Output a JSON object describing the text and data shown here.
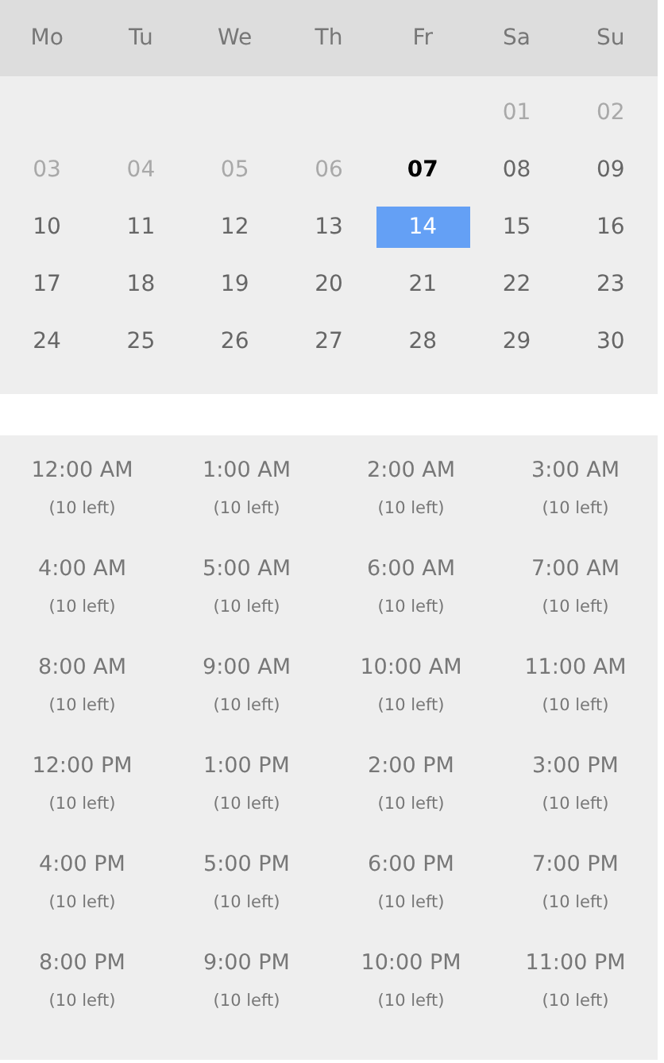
{
  "weekdays": [
    "Mo",
    "Tu",
    "We",
    "Th",
    "Fr",
    "Sa",
    "Su"
  ],
  "weeks": [
    [
      {
        "label": "01",
        "kind": "muted",
        "selected": false
      },
      {
        "label": "02",
        "kind": "muted",
        "selected": false
      }
    ],
    [
      {
        "label": "03",
        "kind": "muted",
        "selected": false
      },
      {
        "label": "04",
        "kind": "muted",
        "selected": false
      },
      {
        "label": "05",
        "kind": "muted",
        "selected": false
      },
      {
        "label": "06",
        "kind": "muted",
        "selected": false
      },
      {
        "label": "07",
        "kind": "today",
        "selected": false
      },
      {
        "label": "08",
        "kind": "normal",
        "selected": false
      },
      {
        "label": "09",
        "kind": "normal",
        "selected": false
      }
    ],
    [
      {
        "label": "10",
        "kind": "normal",
        "selected": false
      },
      {
        "label": "11",
        "kind": "normal",
        "selected": false
      },
      {
        "label": "12",
        "kind": "normal",
        "selected": false
      },
      {
        "label": "13",
        "kind": "normal",
        "selected": false
      },
      {
        "label": "14",
        "kind": "normal",
        "selected": true
      },
      {
        "label": "15",
        "kind": "normal",
        "selected": false
      },
      {
        "label": "16",
        "kind": "normal",
        "selected": false
      }
    ],
    [
      {
        "label": "17",
        "kind": "normal",
        "selected": false
      },
      {
        "label": "18",
        "kind": "normal",
        "selected": false
      },
      {
        "label": "19",
        "kind": "normal",
        "selected": false
      },
      {
        "label": "20",
        "kind": "normal",
        "selected": false
      },
      {
        "label": "21",
        "kind": "normal",
        "selected": false
      },
      {
        "label": "22",
        "kind": "normal",
        "selected": false
      },
      {
        "label": "23",
        "kind": "normal",
        "selected": false
      }
    ],
    [
      {
        "label": "24",
        "kind": "normal",
        "selected": false
      },
      {
        "label": "25",
        "kind": "normal",
        "selected": false
      },
      {
        "label": "26",
        "kind": "normal",
        "selected": false
      },
      {
        "label": "27",
        "kind": "normal",
        "selected": false
      },
      {
        "label": "28",
        "kind": "normal",
        "selected": false
      },
      {
        "label": "29",
        "kind": "normal",
        "selected": false
      },
      {
        "label": "30",
        "kind": "normal",
        "selected": false
      }
    ]
  ],
  "time_slots": [
    {
      "time": "12:00 AM",
      "availability": "(10 left)"
    },
    {
      "time": "1:00 AM",
      "availability": "(10 left)"
    },
    {
      "time": "2:00 AM",
      "availability": "(10 left)"
    },
    {
      "time": "3:00 AM",
      "availability": "(10 left)"
    },
    {
      "time": "4:00 AM",
      "availability": "(10 left)"
    },
    {
      "time": "5:00 AM",
      "availability": "(10 left)"
    },
    {
      "time": "6:00 AM",
      "availability": "(10 left)"
    },
    {
      "time": "7:00 AM",
      "availability": "(10 left)"
    },
    {
      "time": "8:00 AM",
      "availability": "(10 left)"
    },
    {
      "time": "9:00 AM",
      "availability": "(10 left)"
    },
    {
      "time": "10:00 AM",
      "availability": "(10 left)"
    },
    {
      "time": "11:00 AM",
      "availability": "(10 left)"
    },
    {
      "time": "12:00 PM",
      "availability": "(10 left)"
    },
    {
      "time": "1:00 PM",
      "availability": "(10 left)"
    },
    {
      "time": "2:00 PM",
      "availability": "(10 left)"
    },
    {
      "time": "3:00 PM",
      "availability": "(10 left)"
    },
    {
      "time": "4:00 PM",
      "availability": "(10 left)"
    },
    {
      "time": "5:00 PM",
      "availability": "(10 left)"
    },
    {
      "time": "6:00 PM",
      "availability": "(10 left)"
    },
    {
      "time": "7:00 PM",
      "availability": "(10 left)"
    },
    {
      "time": "8:00 PM",
      "availability": "(10 left)"
    },
    {
      "time": "9:00 PM",
      "availability": "(10 left)"
    },
    {
      "time": "10:00 PM",
      "availability": "(10 left)"
    },
    {
      "time": "11:00 PM",
      "availability": "(10 left)"
    }
  ]
}
